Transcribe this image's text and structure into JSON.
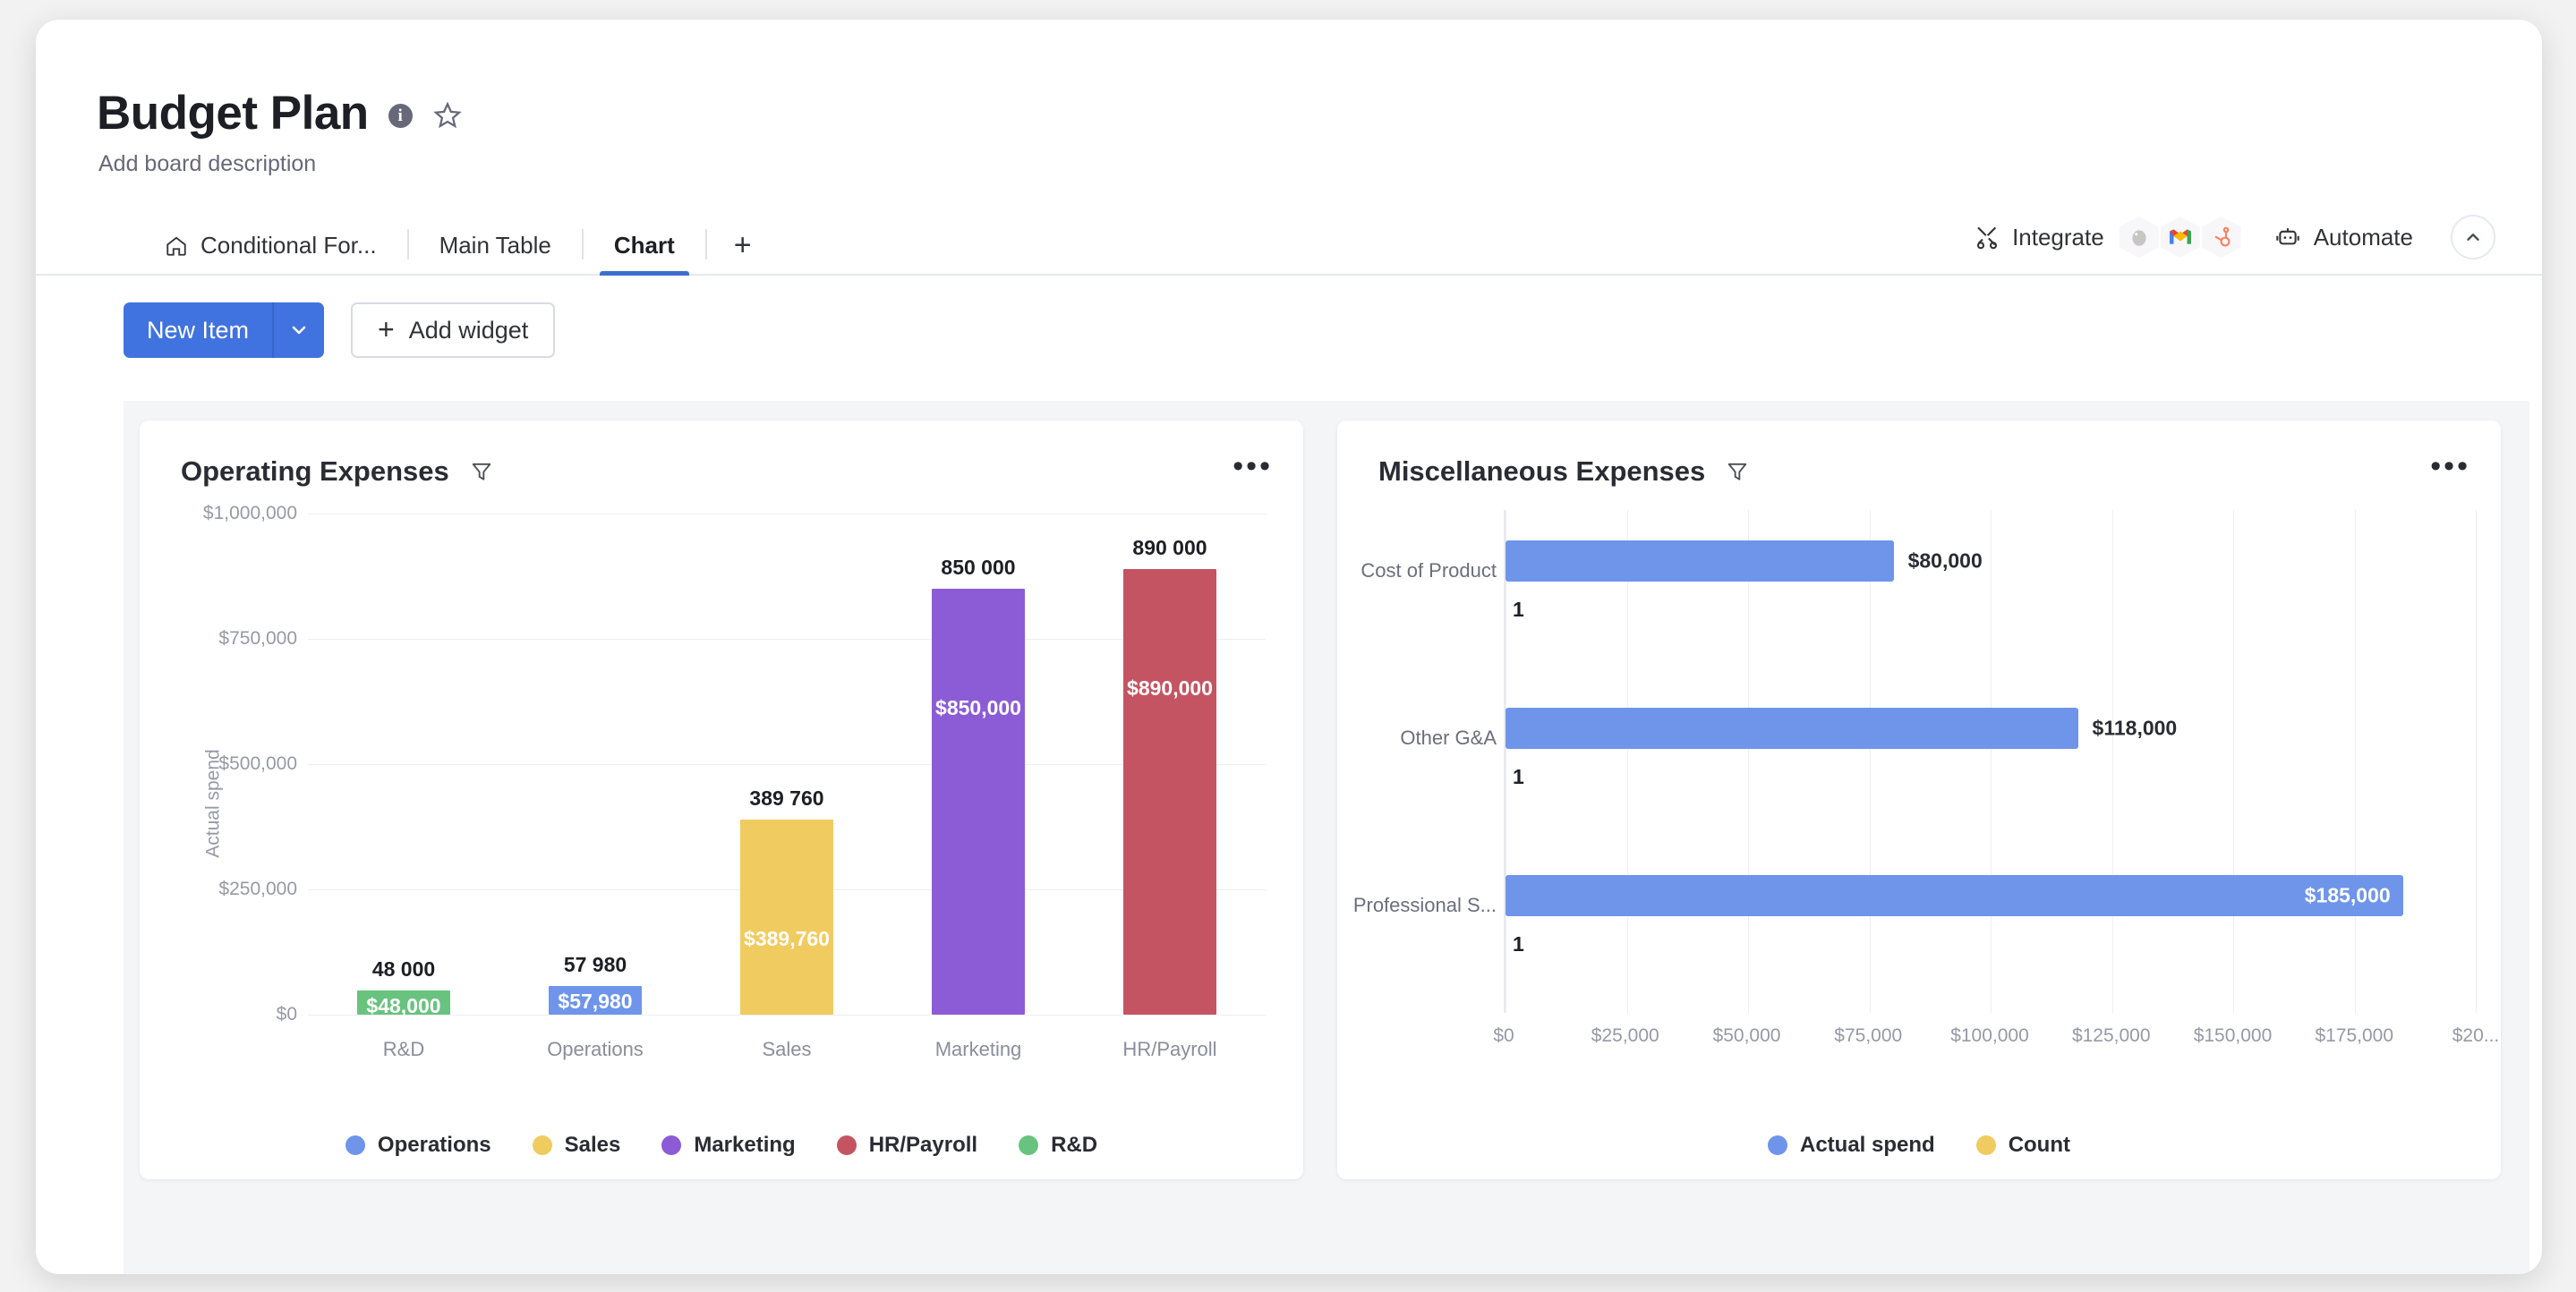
{
  "board": {
    "title": "Budget Plan",
    "description": "Add board description",
    "info_icon": "info-icon",
    "star_icon": "star-outline-icon"
  },
  "tabs": [
    {
      "label": "Conditional For...",
      "icon": "home-icon",
      "active": false
    },
    {
      "label": "Main Table",
      "active": false
    },
    {
      "label": "Chart",
      "active": true
    }
  ],
  "tab_add_label": "+",
  "toolbar_right": {
    "integrate_label": "Integrate",
    "integrate_icon": "integrate-icon",
    "integration_apps": [
      "mailchimp-icon",
      "gmail-icon",
      "hubspot-icon"
    ],
    "automate_label": "Automate",
    "automate_icon": "robot-icon",
    "collapse_icon": "chevron-up-icon"
  },
  "actions": {
    "new_item_label": "New Item",
    "new_item_caret": "chevron-down-icon",
    "add_widget_label": "Add widget",
    "add_widget_plus": "+"
  },
  "colors": {
    "accent_blue": "#4073df",
    "tab_underline": "#3d6ecf",
    "series_operations": "#6e95ea",
    "series_sales": "#f0cb5f",
    "series_marketing": "#8b5cd6",
    "series_hr_payroll": "#c45462",
    "series_rnd": "#68c37f",
    "bar_blue": "#6e95ea",
    "count_yellow": "#f0cb5f"
  },
  "widgets": [
    {
      "title": "Operating Expenses",
      "filter_icon": "funnel-icon",
      "menu_icon": "more-options-icon"
    },
    {
      "title": "Miscellaneous Expenses",
      "filter_icon": "funnel-icon",
      "menu_icon": "more-options-icon"
    }
  ],
  "chart_data": [
    {
      "type": "bar",
      "title": "Operating Expenses",
      "orientation": "vertical",
      "categories": [
        "R&D",
        "Operations",
        "Sales",
        "Marketing",
        "HR/Payroll"
      ],
      "values": [
        48000,
        57980,
        389760,
        850000,
        890000
      ],
      "top_labels": [
        "48 000",
        "57 980",
        "389 760",
        "850 000",
        "890 000"
      ],
      "inner_labels": [
        "$48,000",
        "$57,980",
        "$389,760",
        "$850,000",
        "$890,000"
      ],
      "bar_colors": [
        "#68c37f",
        "#6e95ea",
        "#f0cb5f",
        "#8b5cd6",
        "#c45462"
      ],
      "xlabel": "",
      "ylabel": "Actual spend",
      "ylim": [
        0,
        1000000
      ],
      "yticks": [
        0,
        250000,
        500000,
        750000,
        1000000
      ],
      "ytick_labels": [
        "$0",
        "$250,000",
        "$500,000",
        "$750,000",
        "$1,000,000"
      ],
      "grid": true,
      "legend_position": "bottom",
      "legend": [
        {
          "label": "Operations",
          "color": "#6e95ea"
        },
        {
          "label": "Sales",
          "color": "#f0cb5f"
        },
        {
          "label": "Marketing",
          "color": "#8b5cd6"
        },
        {
          "label": "HR/Payroll",
          "color": "#c45462"
        },
        {
          "label": "R&D",
          "color": "#68c37f"
        }
      ]
    },
    {
      "type": "bar",
      "title": "Miscellaneous Expenses",
      "orientation": "horizontal",
      "categories": [
        "Cost of Product",
        "Other G&A",
        "Professional S..."
      ],
      "series": [
        {
          "name": "Actual spend",
          "color": "#6e95ea",
          "values": [
            80000,
            118000,
            185000
          ],
          "labels": [
            "$80,000",
            "$118,000",
            "$185,000"
          ],
          "label_inside": [
            false,
            false,
            true
          ]
        },
        {
          "name": "Count",
          "color": "#f0cb5f",
          "values": [
            1,
            1,
            1
          ],
          "labels": [
            "1",
            "1",
            "1"
          ],
          "label_inside": [
            false,
            false,
            false
          ]
        }
      ],
      "xlim": [
        0,
        200000
      ],
      "xticks": [
        0,
        25000,
        50000,
        75000,
        100000,
        125000,
        150000,
        175000,
        200000
      ],
      "xtick_labels": [
        "$0",
        "$25,000",
        "$50,000",
        "$75,000",
        "$100,000",
        "$125,000",
        "$150,000",
        "$175,000",
        "$20..."
      ],
      "xlabel": "",
      "ylabel": "",
      "grid": true,
      "legend_position": "bottom",
      "legend": [
        {
          "label": "Actual spend",
          "color": "#6e95ea"
        },
        {
          "label": "Count",
          "color": "#f0cb5f"
        }
      ]
    }
  ]
}
